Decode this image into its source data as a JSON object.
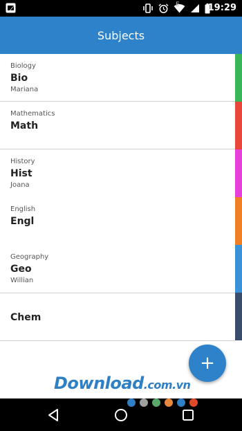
{
  "status_bar": {
    "time": "19:29",
    "carrier": "E",
    "icons": [
      "vibrate-icon",
      "alarm-icon",
      "wifi-icon",
      "signal-icon",
      "battery-icon"
    ]
  },
  "app_bar": {
    "title": "Subjects"
  },
  "subjects": [
    {
      "name": "Biology",
      "abbr": "Bio",
      "teacher": "Mariana",
      "color": "#3ab55a"
    },
    {
      "name": "Mathematics",
      "abbr": "Math",
      "teacher": "",
      "color": "#e8473c"
    },
    {
      "name": "History",
      "abbr": "Hist",
      "teacher": "Joana",
      "color": "#e640d8"
    },
    {
      "name": "English",
      "abbr": "Engl",
      "teacher": "",
      "color": "#ee7f25"
    },
    {
      "name": "Geography",
      "abbr": "Geo",
      "teacher": "Willian",
      "color": "#3a93d8"
    },
    {
      "name": "",
      "abbr": "Chem",
      "teacher": "",
      "color": "#3a4e6b"
    }
  ],
  "fab": {
    "icon": "plus-icon",
    "color": "#2e82c9"
  },
  "watermark": {
    "text": "Download",
    "suffix": ".com.vn",
    "dot_colors": [
      "#2f7fc4",
      "#a0a0a0",
      "#5aa86a",
      "#e8883a",
      "#2f7fc4",
      "#e04a2a"
    ]
  },
  "nav_bar": {
    "icons": [
      "back-icon",
      "home-icon",
      "recents-icon"
    ]
  },
  "colors": {
    "primary": "#2e82c9"
  }
}
